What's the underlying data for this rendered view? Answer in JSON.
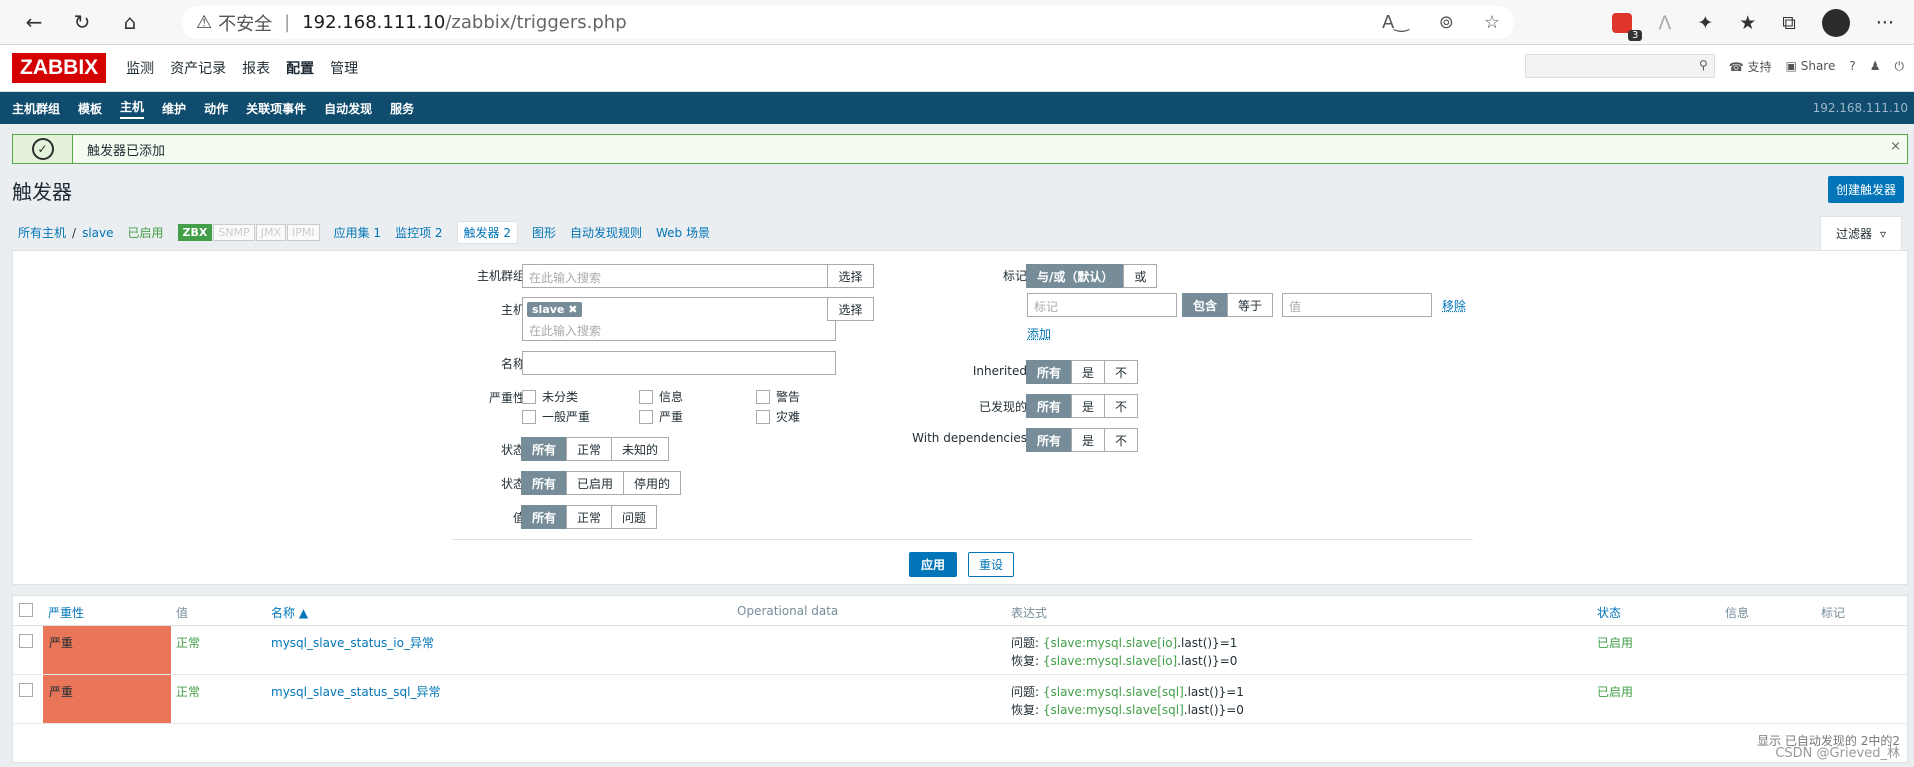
{
  "browser": {
    "insecure_label": "不安全",
    "separator": "|",
    "url_host": "192.168.111.10",
    "url_path": "/zabbix/triggers.php",
    "ext_badge_count": "3",
    "more": "···"
  },
  "nav": {
    "logo": "ZABBIX",
    "main_menu": [
      "监测",
      "资产记录",
      "报表",
      "配置",
      "管理"
    ],
    "support": "支持",
    "share": "Share",
    "help": "?"
  },
  "subnav": {
    "items": [
      "主机群组",
      "模板",
      "主机",
      "维护",
      "动作",
      "关联项事件",
      "自动发现",
      "服务"
    ],
    "server_ip": "192.168.111.10"
  },
  "message": {
    "text": "触发器已添加",
    "close": "×"
  },
  "page": {
    "title": "触发器",
    "create_button": "创建触发器"
  },
  "breadcrumb": {
    "all_hosts": "所有主机",
    "slash": "/",
    "host": "slave",
    "enabled": "已启用",
    "tags": [
      "ZBX",
      "SNMP",
      "JMX",
      "IPMI"
    ],
    "apps": "应用集 1",
    "items": "监控项 2",
    "triggers": "触发器 2",
    "graphs": "图形",
    "discovery": "自动发现规则",
    "web": "Web 场景"
  },
  "filter": {
    "tab_label": "过滤器",
    "host_group_label": "主机群组",
    "search_placeholder": "在此输入搜索",
    "select": "选择",
    "host_label": "主机",
    "host_chip": "slave",
    "name_label": "名称",
    "severity_label": "严重性",
    "severities": [
      "未分类",
      "信息",
      "警告",
      "一般严重",
      "严重",
      "灾难"
    ],
    "state_label": "状态",
    "state_options": [
      "所有",
      "正常",
      "未知的"
    ],
    "status_label": "状态",
    "status_options": [
      "所有",
      "已启用",
      "停用的"
    ],
    "value_label": "值",
    "value_options": [
      "所有",
      "正常",
      "问题"
    ],
    "tags_label": "标记",
    "tag_mode": [
      "与/或（默认）",
      "或"
    ],
    "tag_placeholder": "标记",
    "tag_ops": [
      "包含",
      "等于"
    ],
    "value_placeholder": "值",
    "remove": "移除",
    "add": "添加",
    "inherited_label": "Inherited",
    "discovered_label": "已发现的",
    "deps_label": "With dependencies",
    "triple": [
      "所有",
      "是",
      "不"
    ],
    "apply": "应用",
    "reset": "重设"
  },
  "table": {
    "headers": [
      "严重性",
      "值",
      "名称 ▲",
      "Operational data",
      "表达式",
      "状态",
      "信息",
      "标记"
    ],
    "rows": [
      {
        "severity": "严重",
        "value": "正常",
        "name": "mysql_slave_status_io_异常",
        "problem_label": "问题: ",
        "problem_key": "{slave:mysql.slave[io]",
        "problem_fn": ".last()}=1",
        "recovery_label": "恢复: ",
        "recovery_key": "{slave:mysql.slave[io]",
        "recovery_fn": ".last()}=0",
        "status": "已启用"
      },
      {
        "severity": "严重",
        "value": "正常",
        "name": "mysql_slave_status_sql_异常",
        "problem_label": "问题: ",
        "problem_key": "{slave:mysql.slave[sql]",
        "problem_fn": ".last()}=1",
        "recovery_label": "恢复: ",
        "recovery_key": "{slave:mysql.slave[sql]",
        "recovery_fn": ".last()}=0",
        "status": "已启用"
      }
    ],
    "footer": "显示 已自动发现的 2中的2",
    "watermark": "CSDN @Grieved_林"
  }
}
